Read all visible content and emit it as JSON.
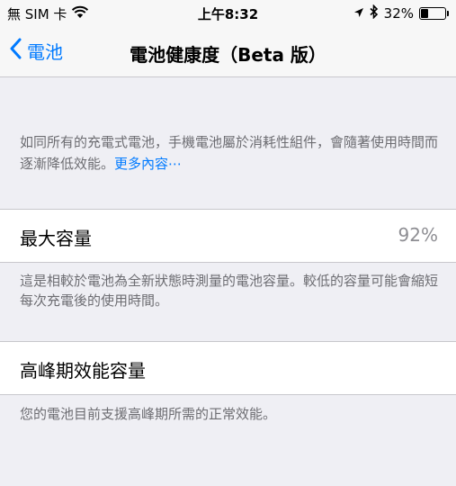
{
  "status_bar": {
    "carrier": "無 SIM 卡",
    "time": "上午8:32",
    "battery_percent": "32%",
    "battery_level": 0.32,
    "icons": [
      "wifi-icon",
      "location-arrow-icon",
      "bluetooth-icon",
      "battery-icon"
    ]
  },
  "nav": {
    "back_label": "電池",
    "title": "電池健康度（Beta 版）"
  },
  "description": {
    "text": "如同所有的充電式電池，手機電池屬於消耗性組件，會隨著使用時間而逐漸降低效能。",
    "link": "更多內容⋯"
  },
  "max_capacity": {
    "label": "最大容量",
    "value": "92%",
    "footer": "這是相較於電池為全新狀態時測量的電池容量。較低的容量可能會縮短每次充電後的使用時間。"
  },
  "peak_performance": {
    "label": "高峰期效能容量",
    "footer": "您的電池目前支援高峰期所需的正常效能。"
  },
  "colors": {
    "accent": "#007aff",
    "background": "#efeff4",
    "secondary_text": "#6d6d72",
    "value_text": "#8e8e93"
  }
}
